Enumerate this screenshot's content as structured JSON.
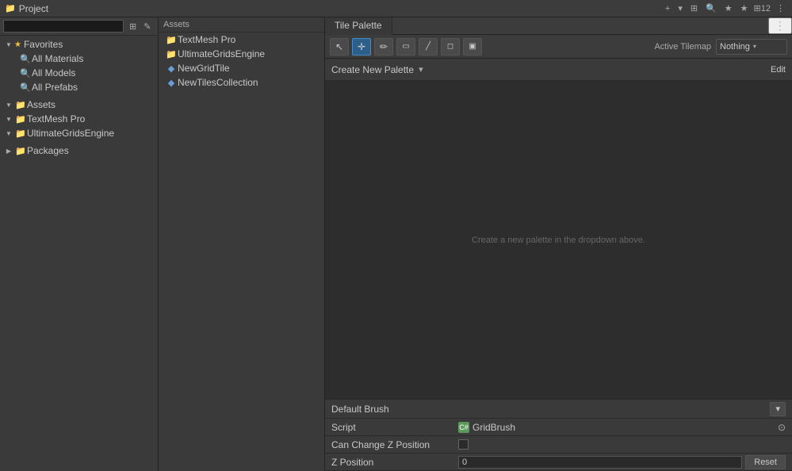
{
  "topbar": {
    "title": "Project",
    "folder_icon": "📁",
    "star_count": "12",
    "more_icon": "⋮"
  },
  "search": {
    "placeholder": "",
    "icon_filter": "☰",
    "icon_star": "★",
    "icon_star2": "★"
  },
  "tree": {
    "favorites_label": "Favorites",
    "favorites_items": [
      {
        "label": "All Materials"
      },
      {
        "label": "All Models"
      },
      {
        "label": "All Prefabs"
      }
    ],
    "assets_label": "Assets",
    "assets_items": [
      {
        "label": "TextMesh Pro",
        "type": "folder"
      },
      {
        "label": "UltimateGridsEngine",
        "type": "folder"
      },
      {
        "label": "NewGridTile",
        "type": "asset"
      },
      {
        "label": "NewTilesCollection",
        "type": "asset"
      }
    ],
    "packages_label": "Packages",
    "packages_items": [],
    "root_assets_label": "Assets",
    "root_assets_children": [
      {
        "label": "TextMesh Pro",
        "type": "folder"
      },
      {
        "label": "UltimateGridsEngine",
        "type": "folder"
      }
    ]
  },
  "tile_palette": {
    "tab_label": "Tile Palette",
    "toolbar": {
      "btn_select": "↖",
      "btn_move": "✛",
      "btn_paint": "✏",
      "btn_rect": "▭",
      "btn_picker": "/",
      "btn_erase": "◻",
      "btn_fill": "▣",
      "active_tool": "move",
      "active_tilemap_label": "Active Tilemap",
      "active_tilemap_value": "Nothing",
      "dropdown_arrow": "▾"
    },
    "create_palette": {
      "label": "Create New Palette",
      "dropdown_arrow": "▾",
      "edit_label": "Edit"
    },
    "hint": "Create a new palette in the dropdown above.",
    "default_brush": {
      "label": "Default Brush",
      "dropdown_arrow": "▾"
    },
    "properties": {
      "script_label": "Script",
      "script_icon": "C#",
      "script_value": "GridBrush",
      "can_change_z_label": "Can Change Z Position",
      "z_position_label": "Z Position",
      "z_position_value": "0",
      "reset_label": "Reset"
    }
  }
}
